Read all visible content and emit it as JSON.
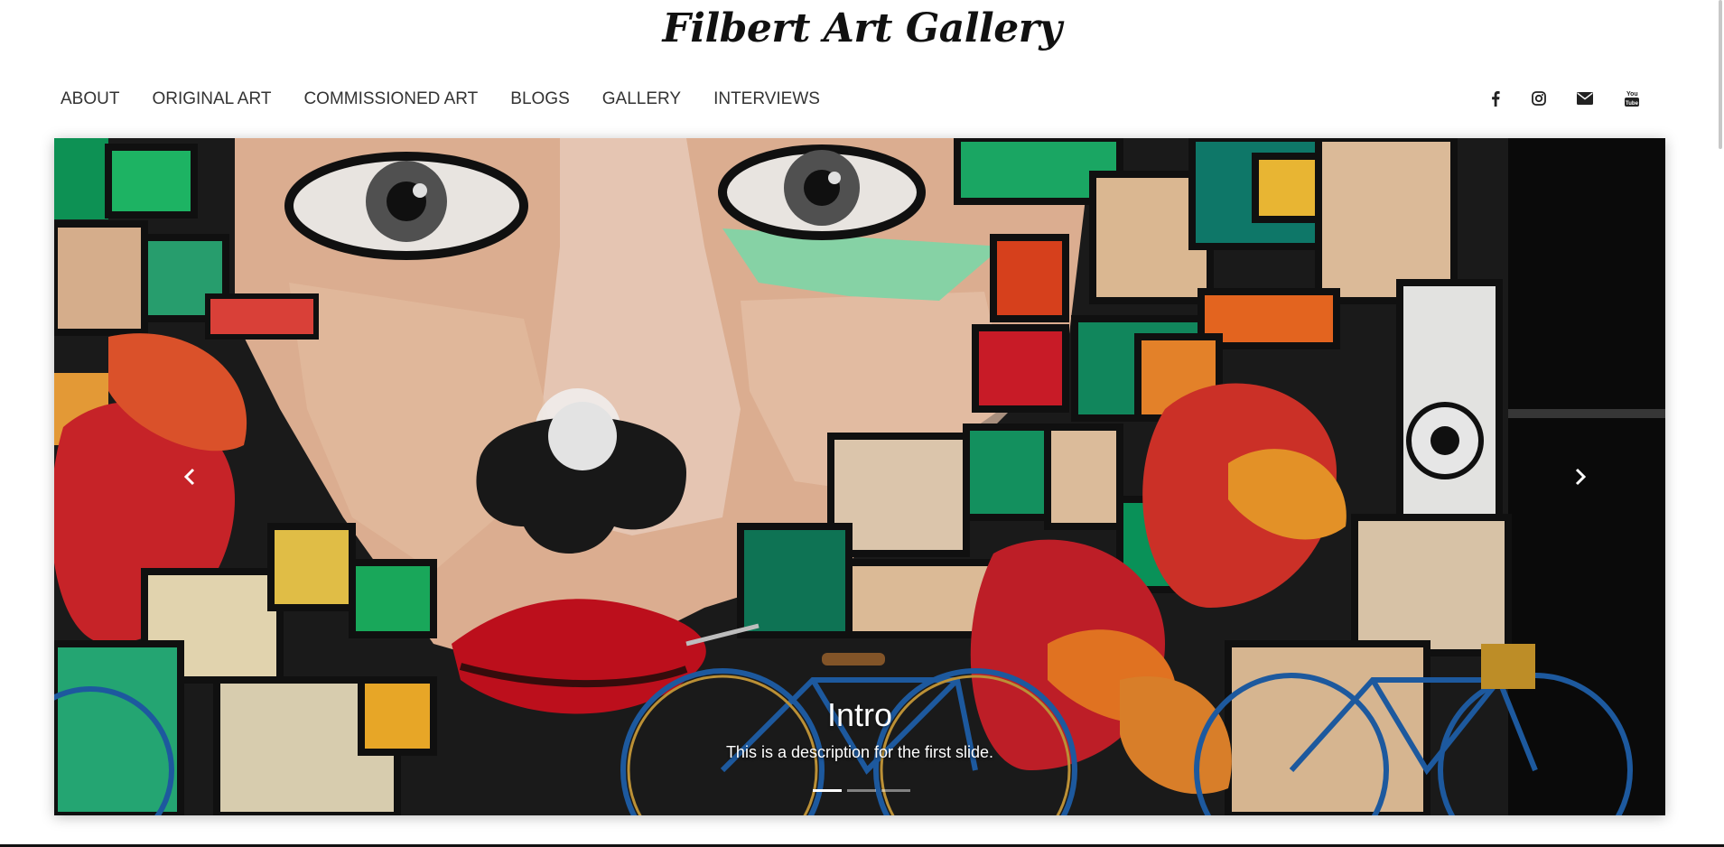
{
  "site": {
    "title": "Filbert Art Gallery"
  },
  "nav": {
    "items": [
      {
        "label": "ABOUT"
      },
      {
        "label": "ORIGINAL ART"
      },
      {
        "label": "COMMISSIONED ART"
      },
      {
        "label": "BLOGS"
      },
      {
        "label": "GALLERY"
      },
      {
        "label": "INTERVIEWS"
      }
    ]
  },
  "social": {
    "icons": [
      "facebook-icon",
      "instagram-icon",
      "envelope-icon",
      "youtube-icon"
    ]
  },
  "carousel": {
    "slide": {
      "title": "Intro",
      "description": "This is a description for the first slide."
    },
    "indicators": {
      "count": 3,
      "active_index": 0
    },
    "controls": {
      "prev_icon": "chevron-left-icon",
      "next_icon": "chevron-right-icon"
    }
  }
}
